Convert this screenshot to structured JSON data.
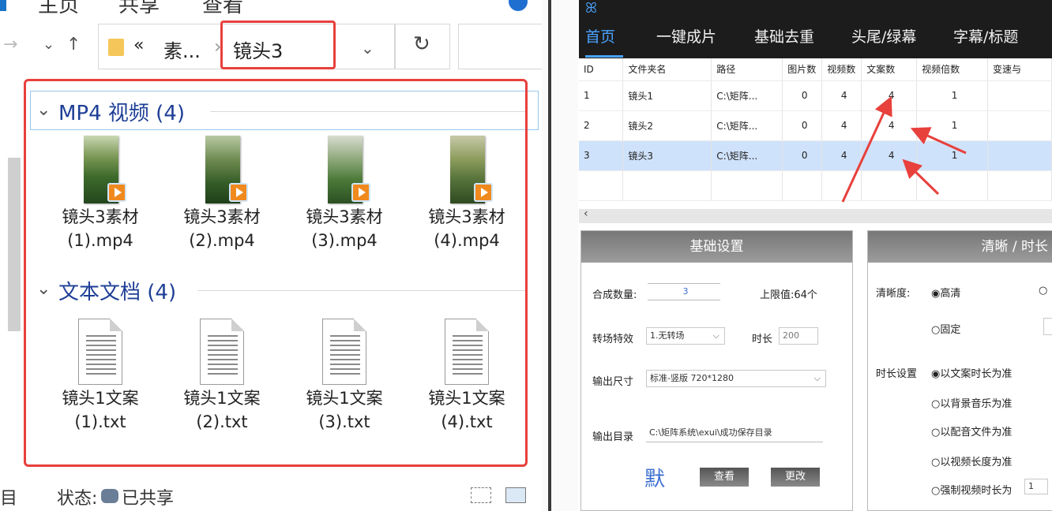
{
  "explorer": {
    "top_partial": [
      "主页",
      "共享",
      "查看"
    ],
    "nav": {
      "back": "→",
      "recent": "⌄",
      "up": "↑"
    },
    "breadcrumb": {
      "overflow": "«",
      "crumb1": "素...",
      "sep": "›",
      "current": "镜头3"
    },
    "address_dropdown": "⌄",
    "refresh": "↻",
    "groups": [
      {
        "chev": "⌄",
        "title": "MP4 视频 (4)",
        "files": [
          {
            "line1": "镜头3素材",
            "line2": "(1).mp4"
          },
          {
            "line1": "镜头3素材",
            "line2": "(2).mp4"
          },
          {
            "line1": "镜头3素材",
            "line2": "(3).mp4"
          },
          {
            "line1": "镜头3素材",
            "line2": "(4).mp4"
          }
        ]
      },
      {
        "chev": "⌄",
        "title": "文本文档 (4)",
        "files": [
          {
            "line1": "镜头1文案",
            "line2": "(1).txt"
          },
          {
            "line1": "镜头1文案",
            "line2": "(2).txt"
          },
          {
            "line1": "镜头1文案",
            "line2": "(3).txt"
          },
          {
            "line1": "镜头1文案",
            "line2": "(4).txt"
          }
        ]
      }
    ],
    "status": {
      "items": "目",
      "state": "状态:",
      "shared": "已共享"
    },
    "colors": {
      "highlight": "#e8403c",
      "group_title": "#1e3f96"
    }
  },
  "app": {
    "logo": "ꕤ",
    "tabs": [
      "首页",
      "一键成片",
      "基础去重",
      "头尾/绿幕",
      "字幕/标题"
    ],
    "table": {
      "headers": [
        "ID",
        "文件夹名",
        "路径",
        "图片数",
        "视频数",
        "文案数",
        "视频倍数",
        "变速与"
      ],
      "rows": [
        [
          "1",
          "镜头1",
          "C:\\矩阵...",
          "0",
          "4",
          "4",
          "1",
          ""
        ],
        [
          "2",
          "镜头2",
          "C:\\矩阵...",
          "0",
          "4",
          "4",
          "1",
          ""
        ],
        [
          "3",
          "镜头3",
          "C:\\矩阵...",
          "0",
          "4",
          "4",
          "1",
          ""
        ]
      ],
      "selected_row": 3
    },
    "scroll_left": "‹",
    "basic": {
      "title": "基础设置",
      "count_label": "合成数量:",
      "count_value": "3",
      "limit_label": "上限值:64个",
      "transition_label": "转场特效",
      "transition_value": "1.无转场",
      "duration_label": "时长",
      "duration_value": "200",
      "size_label": "输出尺寸",
      "size_value": "标准-竖版 720*1280",
      "dir_label": "输出目录",
      "dir_value": "C:\\矩阵系统\\exui\\成功保存目录",
      "default_text": "默",
      "view_btn": "查看",
      "change_btn": "更改",
      "dropdown_glyph": "⌵"
    },
    "clarity": {
      "title": "清晰 / 时长",
      "clarity_label": "清晰度:",
      "hd": "◉高清",
      "other": "○",
      "fixed": "○固定",
      "duration_label": "时长设置",
      "options": [
        "◉以文案时长为准",
        "○以背景音乐为准",
        "○以配音文件为准",
        "○以视频长度为准",
        "○强制视频时长为"
      ],
      "force_value": "1"
    },
    "colors": {
      "accent": "#4aa3ff",
      "arrow": "#e8403c",
      "selected_row": "#cfe2fb"
    }
  }
}
